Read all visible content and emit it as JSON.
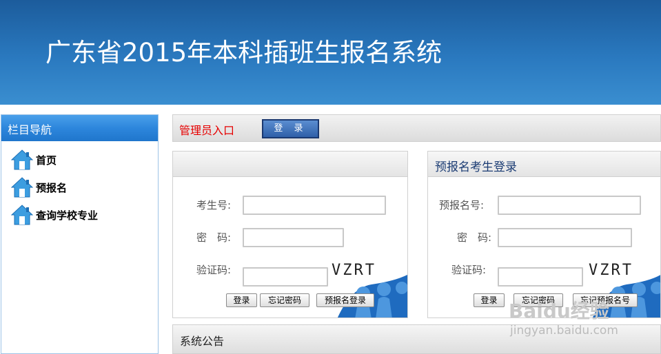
{
  "header": {
    "title": "广东省2015年本科插班生报名系统"
  },
  "sidebar": {
    "title": "栏目导航",
    "items": [
      {
        "label": "首页",
        "icon": "home-icon"
      },
      {
        "label": "预报名",
        "icon": "home-icon"
      },
      {
        "label": "查询学校专业",
        "icon": "home-icon"
      }
    ]
  },
  "admin": {
    "label": "管理员入口",
    "login_label": "登 录"
  },
  "student_login": {
    "title": "",
    "id_label": "考生号:",
    "password_label": "密　码:",
    "captcha_label": "验证码:",
    "captcha_text": "VZRT",
    "login_button": "登录",
    "forgot_password_button": "忘记密码",
    "prereg_login_button": "预报名登录"
  },
  "prereg_login": {
    "title": "预报名考生登录",
    "id_label": "预报名号:",
    "password_label": "密　码:",
    "captcha_label": "验证码:",
    "captcha_text": "VZRT",
    "login_button": "登录",
    "forgot_password_button": "忘记密码",
    "forgot_prereg_button": "忘记预报名号"
  },
  "notice": {
    "title": "系统公告"
  },
  "watermark": {
    "brand": "Baidu经验",
    "url": "jingyan.baidu.com"
  },
  "colors": {
    "banner": "#2a79bf",
    "accent_red": "#e60000",
    "nav_blue": "#2d86dc"
  }
}
